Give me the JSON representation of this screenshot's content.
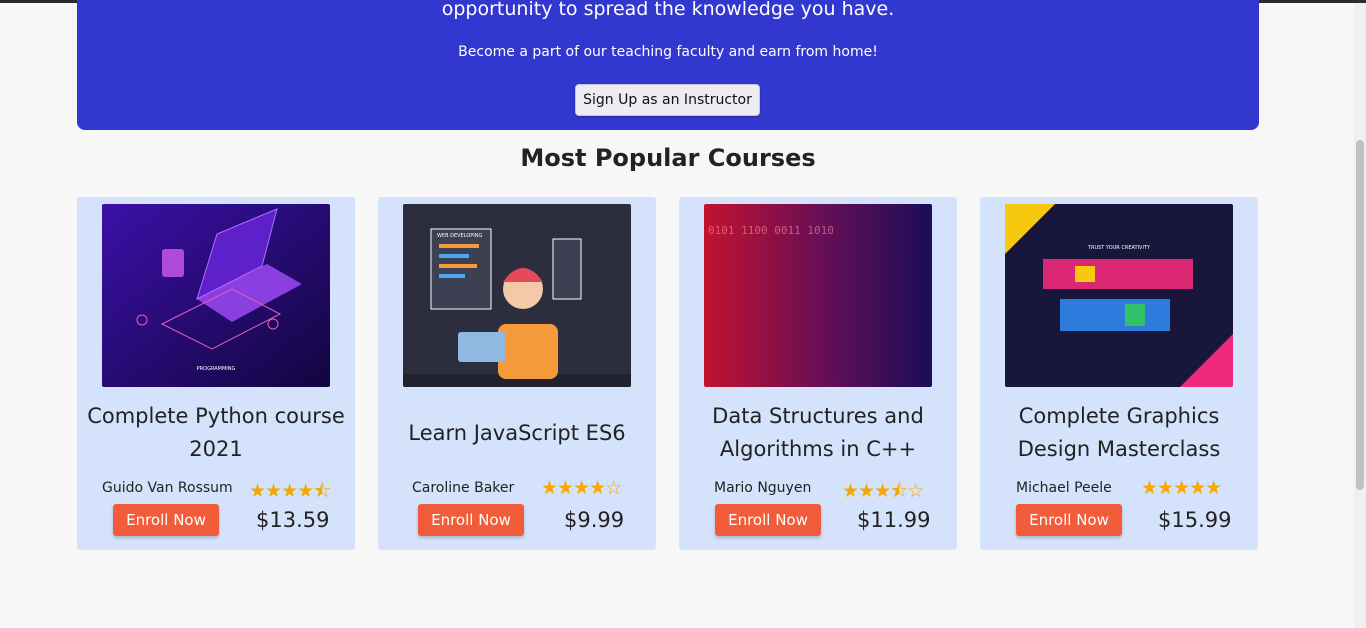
{
  "banner": {
    "headline": "opportunity to spread the knowledge you have.",
    "subline": "Become a part of our teaching faculty and earn from home!",
    "signup_label": "Sign Up as an Instructor"
  },
  "section": {
    "title": "Most Popular Courses"
  },
  "courses": [
    {
      "title": "Complete Python course 2021",
      "author": "Guido Van Rossum",
      "rating": 4.5,
      "stars": "★★★★⯪",
      "enroll_label": "Enroll Now",
      "price": "$13.59",
      "image_text": "PROGRAMMING"
    },
    {
      "title": "Learn JavaScript ES6",
      "author": "Caroline Baker",
      "rating": 4,
      "stars": "★★★★☆",
      "enroll_label": "Enroll Now",
      "price": "$9.99",
      "image_text": "WEB DEVELOPING"
    },
    {
      "title": "Data Structures and Algorithms in C++",
      "author": "Mario Nguyen",
      "rating": 3.5,
      "stars": "★★★⯪☆",
      "enroll_label": "Enroll Now",
      "price": "$11.99",
      "image_text": "0101 1100 0011 1010"
    },
    {
      "title": "Complete Graphics Design Masterclass",
      "author": "Michael Peele",
      "rating": 5,
      "stars": "★★★★★",
      "enroll_label": "Enroll Now",
      "price": "$15.99",
      "image_text": "TRUST YOUR CREATIVITY"
    }
  ],
  "colors": {
    "banner": "#3238cf",
    "card": "#d5e2fb",
    "enroll": "#f25c3b",
    "star": "#f4a900"
  }
}
